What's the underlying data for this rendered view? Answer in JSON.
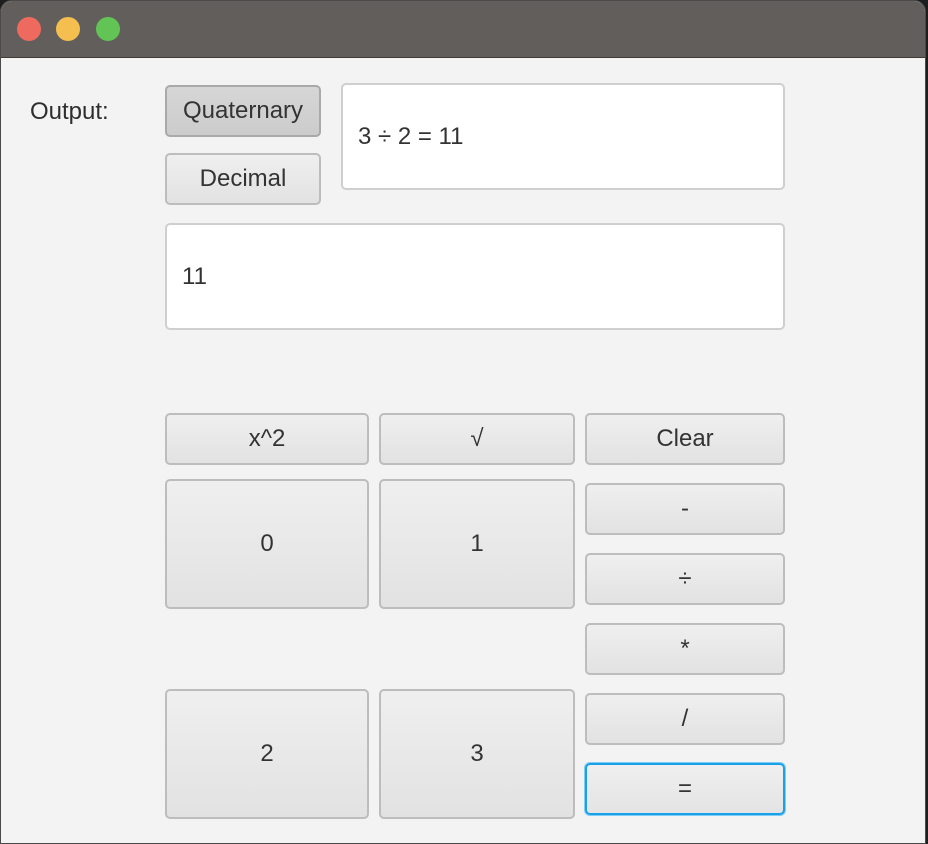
{
  "window": {
    "traffic_lights": [
      "close",
      "minimize",
      "zoom"
    ]
  },
  "output": {
    "label": "Output:",
    "modes": {
      "quaternary": "Quaternary",
      "decimal": "Decimal"
    },
    "selected_mode": "Quaternary"
  },
  "display": {
    "expression": "3 ÷ 2 = 11",
    "result": "11"
  },
  "keypad": {
    "square": "x^2",
    "sqrt": "√",
    "clear": "Clear",
    "digit_0": "0",
    "digit_1": "1",
    "digit_2": "2",
    "digit_3": "3",
    "minus": "-",
    "divide_symbol": "÷",
    "multiply": "*",
    "slash": "/",
    "equals": "="
  },
  "colors": {
    "titlebar": "#625e5b",
    "close": "#ee6a5e",
    "minimize": "#f5bf4f",
    "zoom": "#61c454",
    "focus_ring": "#1aa0e6"
  }
}
